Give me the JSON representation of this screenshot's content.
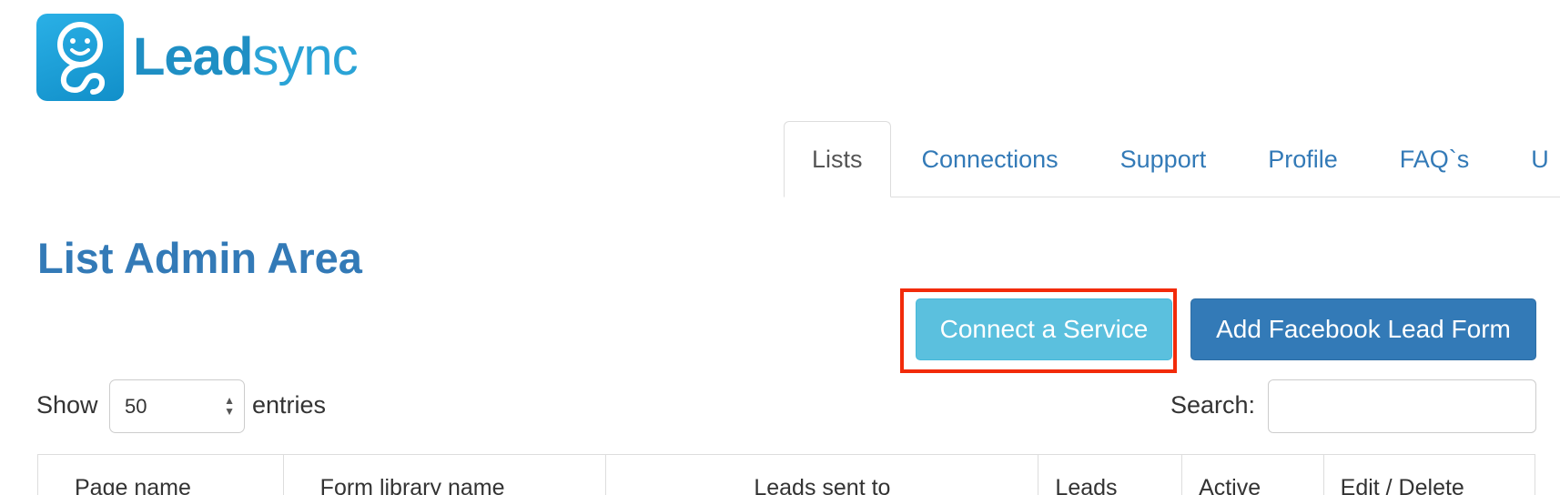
{
  "logo": {
    "brand_bold": "Lead",
    "brand_light": "sync"
  },
  "tabs": [
    {
      "label": "Lists",
      "active": true
    },
    {
      "label": "Connections",
      "active": false
    },
    {
      "label": "Support",
      "active": false
    },
    {
      "label": "Profile",
      "active": false
    },
    {
      "label": "FAQ`s",
      "active": false
    },
    {
      "label": "U",
      "active": false
    }
  ],
  "page_title": "List Admin Area",
  "buttons": {
    "connect": "Connect a Service",
    "add_form": "Add Facebook Lead Form"
  },
  "length_menu": {
    "show_label": "Show",
    "value": "50",
    "entries_label": "entries"
  },
  "search": {
    "label": "Search:",
    "value": ""
  },
  "table": {
    "columns": [
      "Page name",
      "Form library name",
      "Leads sent to",
      "Leads",
      "Active",
      "Edit / Delete"
    ]
  },
  "colors": {
    "primary": "#337ab7",
    "info": "#5bc0de",
    "highlight": "#f22b0a",
    "logo": "#1f8fc4"
  }
}
